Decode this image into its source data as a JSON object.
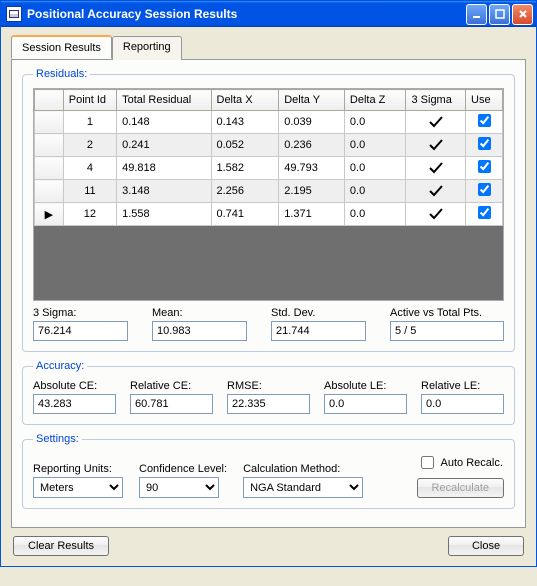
{
  "window": {
    "title": "Positional Accuracy Session Results"
  },
  "tabs": {
    "session": "Session Results",
    "reporting": "Reporting"
  },
  "residuals": {
    "legend": "Residuals:",
    "headers": {
      "point_id": "Point Id",
      "total_residual": "Total Residual",
      "delta_x": "Delta X",
      "delta_y": "Delta Y",
      "delta_z": "Delta Z",
      "three_sigma": "3 Sigma",
      "use": "Use"
    },
    "rows": [
      {
        "marker": "",
        "point_id": "1",
        "total_residual": "0.148",
        "delta_x": "0.143",
        "delta_y": "0.039",
        "delta_z": "0.0",
        "sigma": true,
        "use": true
      },
      {
        "marker": "",
        "point_id": "2",
        "total_residual": "0.241",
        "delta_x": "0.052",
        "delta_y": "0.236",
        "delta_z": "0.0",
        "sigma": true,
        "use": true
      },
      {
        "marker": "",
        "point_id": "4",
        "total_residual": "49.818",
        "delta_x": "1.582",
        "delta_y": "49.793",
        "delta_z": "0.0",
        "sigma": true,
        "use": true
      },
      {
        "marker": "",
        "point_id": "11",
        "total_residual": "3.148",
        "delta_x": "2.256",
        "delta_y": "2.195",
        "delta_z": "0.0",
        "sigma": true,
        "use": true
      },
      {
        "marker": "▶",
        "point_id": "12",
        "total_residual": "1.558",
        "delta_x": "0.741",
        "delta_y": "1.371",
        "delta_z": "0.0",
        "sigma": true,
        "use": true
      }
    ],
    "stats": {
      "three_sigma_label": "3 Sigma:",
      "three_sigma": "76.214",
      "mean_label": "Mean:",
      "mean": "10.983",
      "std_dev_label": "Std. Dev.",
      "std_dev": "21.744",
      "active_label": "Active vs Total Pts.",
      "active": "5 / 5"
    }
  },
  "accuracy": {
    "legend": "Accuracy:",
    "abs_ce_label": "Absolute CE:",
    "abs_ce": "43.283",
    "rel_ce_label": "Relative CE:",
    "rel_ce": "60.781",
    "rmse_label": "RMSE:",
    "rmse": "22.335",
    "abs_le_label": "Absolute LE:",
    "abs_le": "0.0",
    "rel_le_label": "Relative LE:",
    "rel_le": "0.0"
  },
  "settings": {
    "legend": "Settings:",
    "units_label": "Reporting Units:",
    "units_value": "Meters",
    "conf_label": "Confidence Level:",
    "conf_value": "90",
    "method_label": "Calculation Method:",
    "method_value": "NGA Standard",
    "auto_label": "Auto Recalc.",
    "recalc_label": "Recalculate"
  },
  "buttons": {
    "clear": "Clear Results",
    "close": "Close"
  }
}
